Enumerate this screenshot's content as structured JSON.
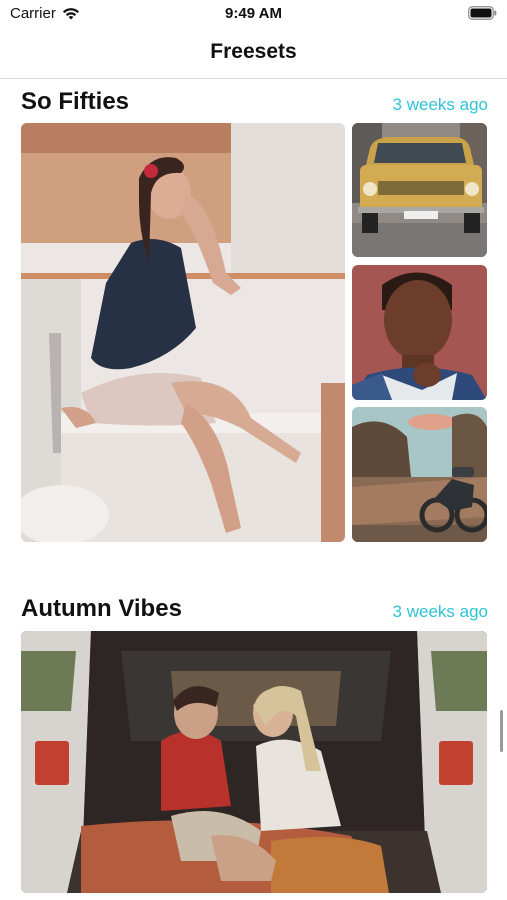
{
  "status_bar": {
    "carrier": "Carrier",
    "time": "9:49 AM",
    "wifi_icon": "wifi-icon",
    "battery_icon": "battery-icon"
  },
  "nav": {
    "title": "Freesets"
  },
  "colors": {
    "accent": "#2ec4d6",
    "divider": "#d9d9d9"
  },
  "sections": [
    {
      "title": "So Fifties",
      "time_ago": "3 weeks ago",
      "photos": [
        "main-photo-woman-on-bathtub",
        "thumb-yellow-car",
        "thumb-portrait",
        "thumb-motorcycle"
      ]
    },
    {
      "title": "Autumn Vibes",
      "time_ago": "3 weeks ago",
      "photos": [
        "main-photo-couple-in-car-trunk"
      ]
    }
  ]
}
